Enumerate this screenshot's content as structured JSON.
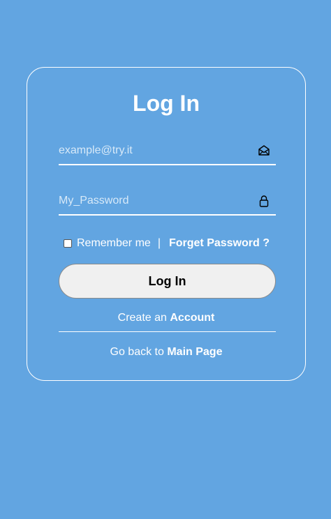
{
  "form": {
    "title": "Log In",
    "email": {
      "placeholder": "example@try.it",
      "value": "",
      "icon": "envelope-icon"
    },
    "password": {
      "placeholder": "My_Password",
      "value": "",
      "icon": "lock-icon"
    },
    "remember_label": "Remember me",
    "remember_checked": false,
    "separator": "|",
    "forget_label": "Forget Password ?",
    "submit_label": "Log In",
    "create_prefix": "Create an",
    "create_link": "Account",
    "back_prefix": "Go back to",
    "back_link": "Main Page"
  },
  "colors": {
    "background": "#62a5e1",
    "card_border": "#ffffff",
    "button_bg": "#f0f0f0",
    "text": "#ffffff"
  }
}
